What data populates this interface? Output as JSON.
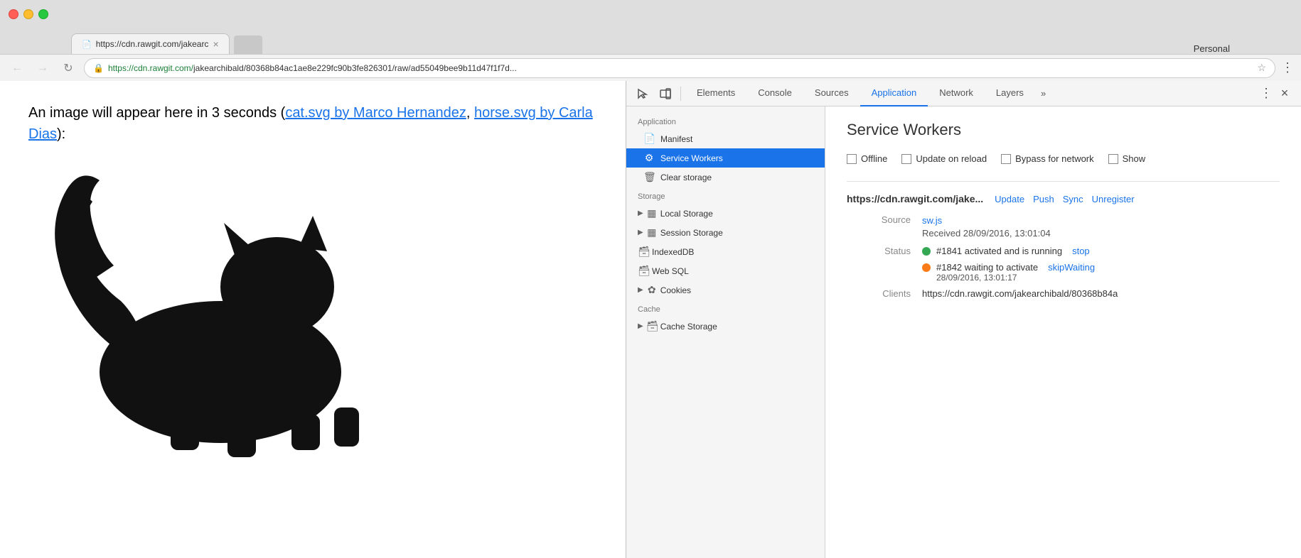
{
  "browser": {
    "tab_favicon": "📄",
    "tab_title": "https://cdn.rawgit.com/jakearc",
    "tab_close": "×",
    "tab_placeholder": "",
    "profile": "Personal",
    "back_icon": "←",
    "forward_icon": "→",
    "refresh_icon": "↻",
    "address_url_green": "https://cdn.rawgit.com/",
    "address_url_rest": "jakearchibald/80368b84ac1ae8e229fc90b3fe826301/raw/ad55049bee9b11d47f1f7d...",
    "bookmark_icon": "☆",
    "menu_icon": "⋮"
  },
  "webcontent": {
    "text_before": "An image will appear here in 3 seconds (",
    "link1": "cat.svg by Marco Hernandez",
    "text_comma": ", ",
    "link2": "horse.svg by Carla Dias",
    "text_after": "):"
  },
  "devtools": {
    "icons": {
      "cursor": "⬚",
      "device": "▭",
      "more_dots": "⋮",
      "close": "×"
    },
    "tabs": [
      {
        "label": "Elements",
        "active": false
      },
      {
        "label": "Console",
        "active": false
      },
      {
        "label": "Sources",
        "active": false
      },
      {
        "label": "Application",
        "active": true
      },
      {
        "label": "Network",
        "active": false
      },
      {
        "label": "Layers",
        "active": false
      }
    ],
    "tabs_more": "»",
    "sidebar": {
      "section_application": "Application",
      "item_manifest": "Manifest",
      "item_service_workers": "Service Workers",
      "item_clear_storage": "Clear storage",
      "section_storage": "Storage",
      "item_local_storage": "Local Storage",
      "item_session_storage": "Session Storage",
      "item_indexeddb": "IndexedDB",
      "item_web_sql": "Web SQL",
      "item_cookies": "Cookies",
      "section_cache": "Cache",
      "item_cache_storage": "Cache Storage"
    },
    "main": {
      "title": "Service Workers",
      "options": [
        {
          "label": "Offline"
        },
        {
          "label": "Update on reload"
        },
        {
          "label": "Bypass for network"
        },
        {
          "label": "Show"
        }
      ],
      "sw_url": "https://cdn.rawgit.com/jake...",
      "sw_actions": [
        "Update",
        "Push",
        "Sync",
        "Unregister"
      ],
      "source_label": "Source",
      "source_file": "sw.js",
      "received_text": "Received 28/09/2016, 13:01:04",
      "status_label": "Status",
      "status_entries": [
        {
          "color": "green",
          "text": "#1841 activated and is running",
          "action": "stop"
        },
        {
          "color": "orange",
          "text": "#1842 waiting to activate",
          "action": "skipWaiting",
          "subtext": "28/09/2016, 13:01:17"
        }
      ],
      "clients_label": "Clients",
      "clients_value": "https://cdn.rawgit.com/jakearchibald/80368b84a"
    }
  }
}
